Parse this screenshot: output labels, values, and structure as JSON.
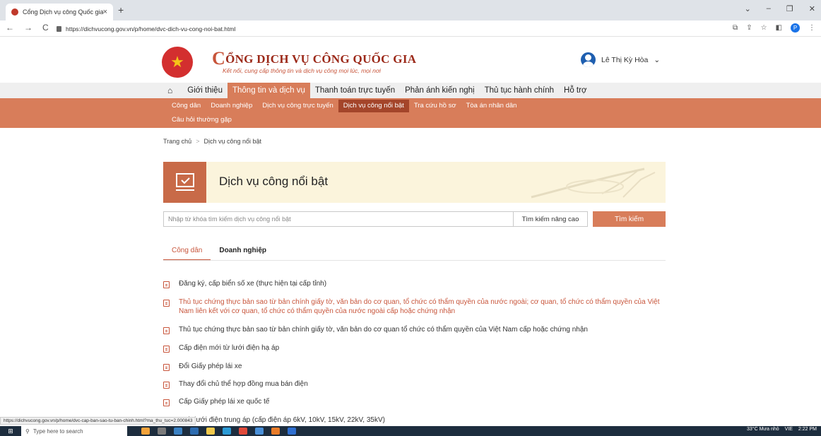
{
  "browser": {
    "tab_title": "Cổng Dịch vụ công Quốc gia",
    "tab_close": "×",
    "new_tab": "+",
    "url": "https://dichvucong.gov.vn/p/home/dvc-dich-vu-cong-noi-bat.html",
    "nav_back": "←",
    "nav_forward": "→",
    "nav_reload": "C",
    "profile_initial": "P",
    "win_min": "–",
    "win_max": "❐",
    "win_close": "✕",
    "tab_menu": "⌄"
  },
  "header": {
    "title_first": "C",
    "title_rest": "ỔNG DỊCH VỤ CÔNG QUỐC GIA",
    "subtitle": "Kết nối, cung cấp thông tin và dịch vụ công mọi lúc, mọi nơi",
    "user_name": "Lê Thị Kỳ Hòa",
    "user_caret": "⌄"
  },
  "main_nav": [
    {
      "label": "Giới thiệu"
    },
    {
      "label": "Thông tin và dịch vụ",
      "active": true
    },
    {
      "label": "Thanh toán trực tuyến"
    },
    {
      "label": "Phản ánh kiến nghị"
    },
    {
      "label": "Thủ tục hành chính"
    },
    {
      "label": "Hỗ trợ"
    }
  ],
  "sub_nav": {
    "row1": [
      {
        "label": "Công dân"
      },
      {
        "label": "Doanh nghiệp"
      },
      {
        "label": "Dịch vụ công trực tuyến"
      },
      {
        "label": "Dịch vụ công nổi bật",
        "active": true
      },
      {
        "label": "Tra cứu hồ sơ"
      },
      {
        "label": "Tòa án nhân dân"
      }
    ],
    "row2": [
      {
        "label": "Câu hỏi thường gặp"
      }
    ]
  },
  "breadcrumb": {
    "home": "Trang chủ",
    "separator": ">",
    "current": "Dịch vụ công nổi bật"
  },
  "banner": {
    "title": "Dịch vụ công nổi bật"
  },
  "search": {
    "placeholder": "Nhập từ khóa tìm kiếm dịch vụ công nổi bật",
    "advanced": "Tìm kiếm nâng cao",
    "button": "Tìm kiếm"
  },
  "tabs": [
    {
      "label": "Công dân",
      "active": true
    },
    {
      "label": "Doanh nghiệp"
    }
  ],
  "services": [
    {
      "text": "Đăng ký, cấp biển số xe (thực hiện tại cấp tỉnh)"
    },
    {
      "text": "Thủ tục chứng thực bản sao từ bản chính giấy tờ, văn bản do cơ quan, tổ chức có thẩm quyền của nước ngoài; cơ quan, tổ chức có thẩm quyền của Việt Nam liên kết với cơ quan, tổ chức có thẩm quyền của nước ngoài cấp hoặc chứng nhận",
      "highlighted": true
    },
    {
      "text": "Thủ tục chứng thực bản sao từ bản chính giấy tờ, văn bản do cơ quan tổ chức có thẩm quyền của Việt Nam cấp hoặc chứng nhận"
    },
    {
      "text": "Cấp điện mới từ lưới điện hạ áp"
    },
    {
      "text": "Đổi Giấy phép lái xe"
    },
    {
      "text": "Thay đổi chủ thể hợp đồng mua bán điện"
    },
    {
      "text": "Cấp Giấy phép lái xe quốc tế"
    }
  ],
  "status": {
    "link_url": "https://dichvucong.gov.vn/p/home/dvc-cap-ban-sao-tu-ban-chinh.html?ma_thu_tuc=2.000843",
    "partial_item": "từ lưới điện trung áp (cấp điện áp 6kV, 10kV, 15kV, 22kV, 35kV)"
  },
  "taskbar": {
    "search_placeholder": "Type here to search",
    "weather": "33°C Mưa nhỏ",
    "lang": "VIE",
    "time": "2:22 PM"
  },
  "colors": {
    "accent": "#d87d5a",
    "accent_dark": "#a4452a",
    "highlight_text": "#c8553b",
    "banner_bg": "#fbf4dc"
  }
}
